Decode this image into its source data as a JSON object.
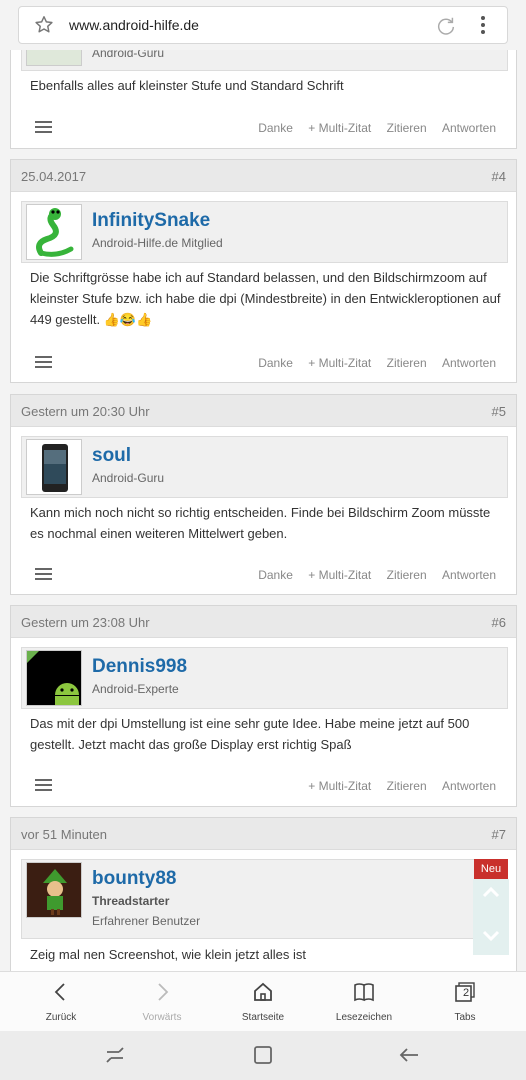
{
  "browser": {
    "url": "www.android-hilfe.de"
  },
  "posts": [
    {
      "role": "Android-Guru",
      "text": "Ebenfalls alles auf kleinster Stufe und Standard Schrift",
      "actions": [
        "Danke",
        "+ Multi-Zitat",
        "Zitieren",
        "Antworten"
      ]
    },
    {
      "date": "25.04.2017",
      "num": "#4",
      "user": "InfinitySnake",
      "role": "Android-Hilfe.de Mitglied",
      "text": "Die Schriftgrösse habe ich auf Standard belassen, und den Bildschirmzoom auf kleinster Stufe bzw. ich habe die dpi (Mindestbreite) in den Entwickleroptionen auf 449 gestellt. 👍😂👍",
      "actions": [
        "Danke",
        "+ Multi-Zitat",
        "Zitieren",
        "Antworten"
      ]
    },
    {
      "date": "Gestern um 20:30 Uhr",
      "num": "#5",
      "user": "soul",
      "role": "Android-Guru",
      "text": "Kann mich noch nicht so richtig entscheiden. Finde bei Bildschirm Zoom müsste es nochmal einen weiteren Mittelwert geben.",
      "actions": [
        "Danke",
        "+ Multi-Zitat",
        "Zitieren",
        "Antworten"
      ]
    },
    {
      "date": "Gestern um 23:08 Uhr",
      "num": "#6",
      "user": "Dennis998",
      "role": "Android-Experte",
      "text": "Das mit der dpi Umstellung ist eine sehr gute Idee. Habe meine jetzt auf 500 gestellt. Jetzt macht das große Display erst richtig Spaß",
      "actions": [
        "+ Multi-Zitat",
        "Zitieren",
        "Antworten"
      ]
    },
    {
      "date": "vor 51 Minuten",
      "num": "#7",
      "user": "bounty88",
      "tag": "Threadstarter",
      "role": "Erfahrener Benutzer",
      "badge": "Neu",
      "text": "Zeig mal nen Screenshot, wie klein jetzt alles ist"
    }
  ],
  "bottom_nav": {
    "back": "Zurück",
    "forward": "Vorwärts",
    "home": "Startseite",
    "bookmarks": "Lesezeichen",
    "tabs": "Tabs",
    "tab_count": "2"
  }
}
